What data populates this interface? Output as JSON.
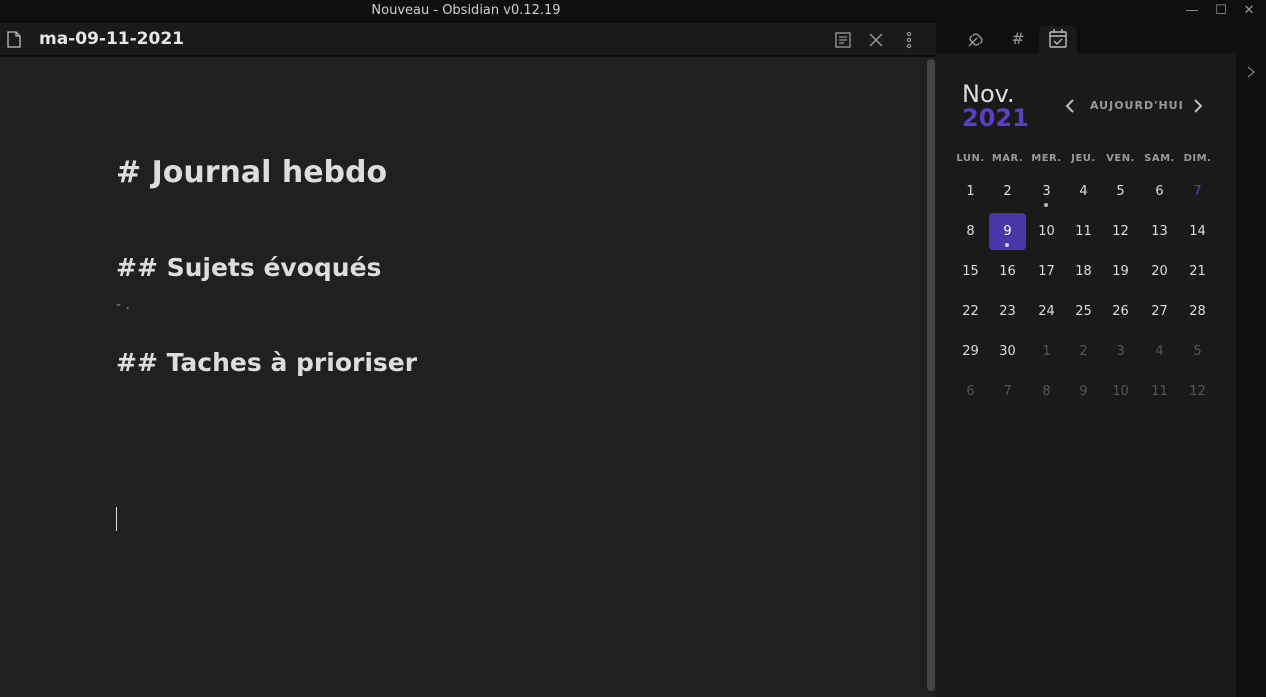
{
  "window": {
    "title": "Nouveau - Obsidian v0.12.19"
  },
  "editor": {
    "file_name": "ma-09-11-2021",
    "h1": "# Journal hebdo",
    "h2_subjects": "## Sujets évoqués",
    "bullet": "- .",
    "h2_tasks": "## Taches à prioriser"
  },
  "calendar": {
    "month": "Nov.",
    "year": "2021",
    "today_label": "AUJOURD'HUI",
    "weekdays": [
      "LUN.",
      "MAR.",
      "MER.",
      "JEU.",
      "VEN.",
      "SAM.",
      "DIM."
    ],
    "weeks": [
      [
        "1",
        "2",
        "3",
        "4",
        "5",
        "6",
        "7"
      ],
      [
        "8",
        "9",
        "10",
        "11",
        "12",
        "13",
        "14"
      ],
      [
        "15",
        "16",
        "17",
        "18",
        "19",
        "20",
        "21"
      ],
      [
        "22",
        "23",
        "24",
        "25",
        "26",
        "27",
        "28"
      ],
      [
        "29",
        "30",
        "1",
        "2",
        "3",
        "4",
        "5"
      ],
      [
        "6",
        "7",
        "8",
        "9",
        "10",
        "11",
        "12"
      ]
    ],
    "accent_color": "#5a3ec8",
    "active_bg": "#4b36a8"
  }
}
